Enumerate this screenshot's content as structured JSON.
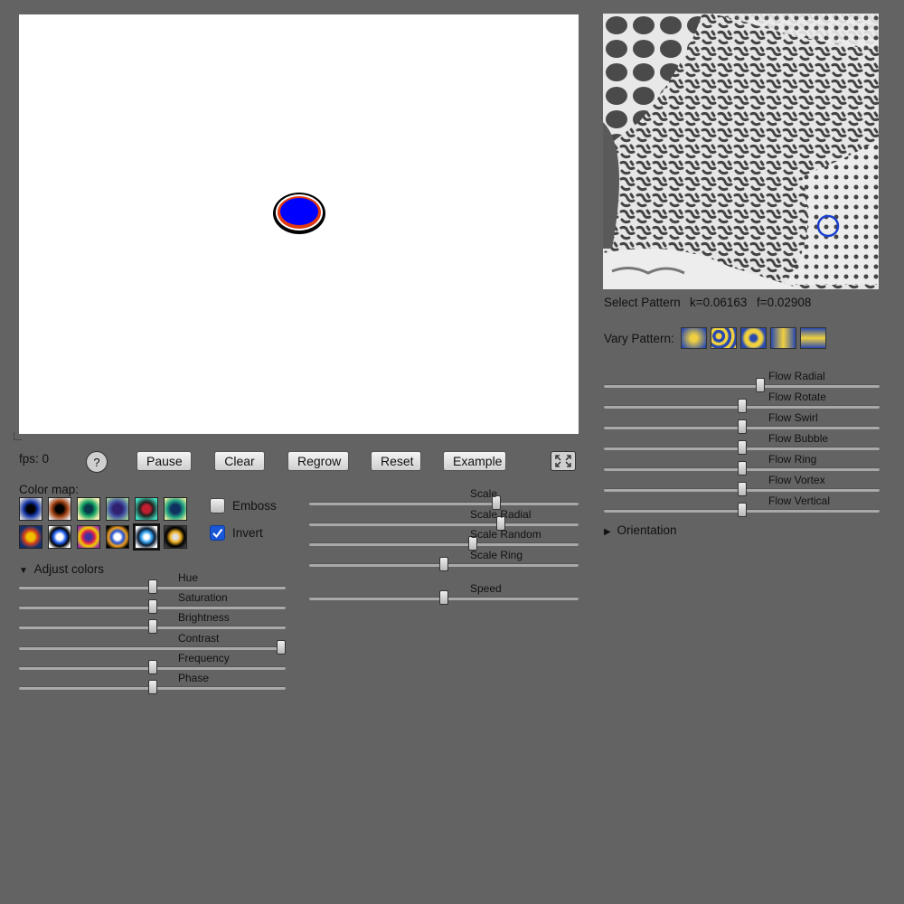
{
  "status": {
    "fps": "fps: 0"
  },
  "buttons": {
    "help": "?",
    "pause": "Pause",
    "clear": "Clear",
    "regrow": "Regrow",
    "reset": "Reset",
    "example": "Example"
  },
  "colormap": {
    "label": "Color map:",
    "selected_index": 10
  },
  "options": {
    "emboss": {
      "label": "Emboss",
      "checked": false
    },
    "invert": {
      "label": "Invert",
      "checked": true
    }
  },
  "adjust_colors": {
    "label": "Adjust colors",
    "expanded": true,
    "sliders": [
      {
        "label": "Hue",
        "value": 0.5
      },
      {
        "label": "Saturation",
        "value": 0.5
      },
      {
        "label": "Brightness",
        "value": 0.5
      },
      {
        "label": "Contrast",
        "value": 1.0
      },
      {
        "label": "Frequency",
        "value": 0.5
      },
      {
        "label": "Phase",
        "value": 0.5
      }
    ]
  },
  "scale_sliders": [
    {
      "label": "Scale",
      "value": 0.7
    },
    {
      "label": "Scale Radial",
      "value": 0.72
    },
    {
      "label": "Scale Random",
      "value": 0.61
    },
    {
      "label": "Scale Ring",
      "value": 0.5
    }
  ],
  "speed_slider": {
    "label": "Speed",
    "value": 0.5
  },
  "pattern": {
    "select_label": "Select Pattern",
    "k": "k=0.06163",
    "f": "f=0.02908",
    "vary_label": "Vary Pattern:"
  },
  "flow_sliders": [
    {
      "label": "Flow Radial",
      "value": 0.57
    },
    {
      "label": "Flow Rotate",
      "value": 0.5
    },
    {
      "label": "Flow Swirl",
      "value": 0.5
    },
    {
      "label": "Flow Bubble",
      "value": 0.5
    },
    {
      "label": "Flow Ring",
      "value": 0.5
    },
    {
      "label": "Flow Vortex",
      "value": 0.5
    },
    {
      "label": "Flow Vertical",
      "value": 0.5
    }
  ],
  "orientation": {
    "label": "Orientation",
    "expanded": false
  },
  "colors": {
    "background": "#636363",
    "accent": "#1a3fd0",
    "blob": "#0000ff"
  },
  "icons": {
    "fullscreen": "fullscreen-icon",
    "disclosure_open": "triangle-down-icon",
    "disclosure_closed": "triangle-right-icon"
  }
}
